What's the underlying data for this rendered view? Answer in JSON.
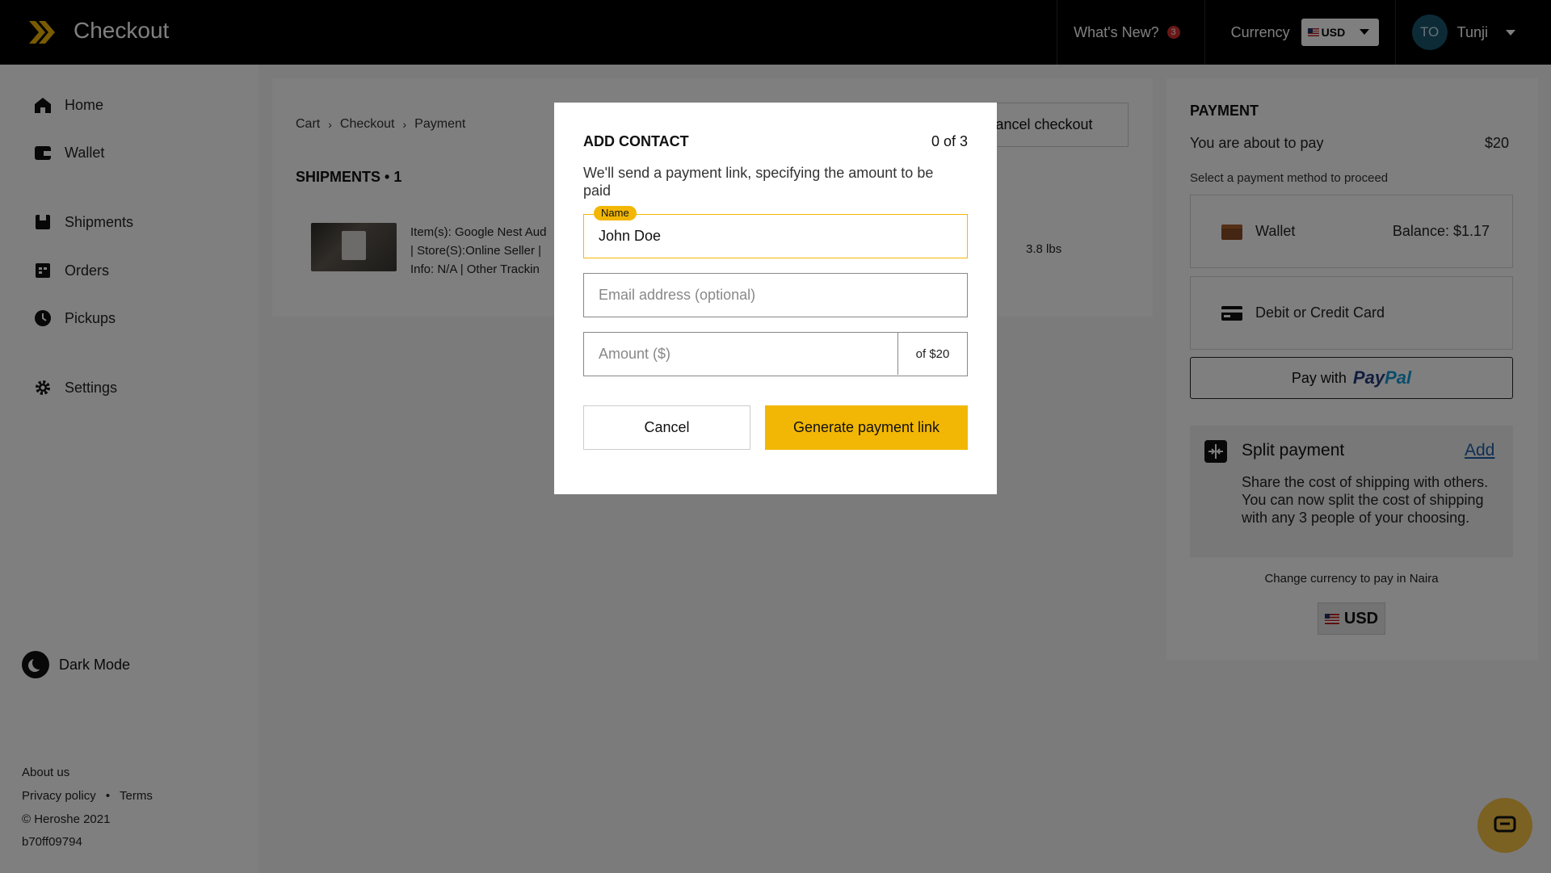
{
  "header": {
    "title": "Checkout",
    "whats_new": "What's New?",
    "whats_new_count": "3",
    "currency_label": "Currency",
    "currency_value": "USD",
    "user_initials": "TO",
    "user_name": "Tunji"
  },
  "sidebar": {
    "items": [
      {
        "label": "Home",
        "icon": "home-icon"
      },
      {
        "label": "Wallet",
        "icon": "wallet-icon"
      },
      {
        "label": "Shipments",
        "icon": "shipments-icon"
      },
      {
        "label": "Orders",
        "icon": "orders-icon"
      },
      {
        "label": "Pickups",
        "icon": "pickups-icon"
      },
      {
        "label": "Settings",
        "icon": "settings-icon"
      }
    ],
    "dark_mode": "Dark Mode",
    "about": "About us",
    "privacy": "Privacy policy",
    "separator": "•",
    "terms": "Terms",
    "copyright": "© Heroshe 2021",
    "build": "b70ff09794"
  },
  "main": {
    "breadcrumb": [
      "Cart",
      "Checkout",
      "Payment"
    ],
    "breadcrumb_separator": "›",
    "cancel_checkout": "Cancel checkout",
    "shipments_title": "SHIPMENTS • 1",
    "item_lines": [
      "Item(s): Google Nest Aud",
      "| Store(S):Online Seller |",
      "Info: N/A | Other Trackin"
    ],
    "weight": "3.8 lbs"
  },
  "payment": {
    "title": "PAYMENT",
    "about_to_pay": "You are about to pay",
    "amount": "$20",
    "select_method": "Select a payment method to proceed",
    "wallet_label": "Wallet",
    "wallet_balance": "Balance: $1.17",
    "card_label": "Debit or Credit Card",
    "paypal_prefix": "Pay with",
    "paypal_brand_1": "Pay",
    "paypal_brand_2": "Pal",
    "split_title": "Split payment",
    "split_add": "Add",
    "split_desc": "Share the cost of shipping with others. You can now split the cost of shipping with any 3 people of your choosing.",
    "change_currency": "Change currency to pay in Naira",
    "currency_button": "USD"
  },
  "modal": {
    "title": "ADD CONTACT",
    "count": "0 of 3",
    "description": "We'll send a payment link, specifying the amount to be paid",
    "name_label": "Name",
    "name_value": "John Doe",
    "email_placeholder": "Email address (optional)",
    "amount_placeholder": "Amount ($)",
    "amount_suffix": "of $20",
    "cancel": "Cancel",
    "generate": "Generate payment link"
  },
  "colors": {
    "accent": "#f2b705",
    "topbar": "#000000",
    "link": "#1f5fa8"
  }
}
